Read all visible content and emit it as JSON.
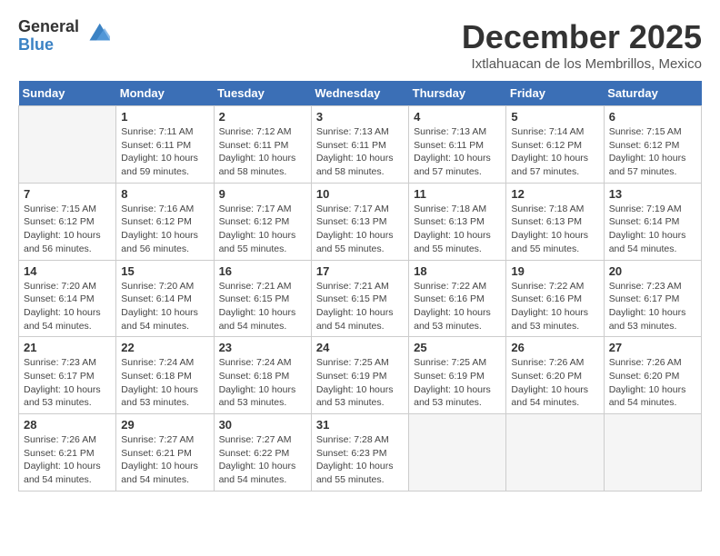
{
  "header": {
    "logo": {
      "general": "General",
      "blue": "Blue"
    },
    "title": "December 2025",
    "subtitle": "Ixtlahuacan de los Membrillos, Mexico"
  },
  "calendar": {
    "weekdays": [
      "Sunday",
      "Monday",
      "Tuesday",
      "Wednesday",
      "Thursday",
      "Friday",
      "Saturday"
    ],
    "weeks": [
      [
        {
          "day": "",
          "sunrise": "",
          "sunset": "",
          "daylight": ""
        },
        {
          "day": "1",
          "sunrise": "Sunrise: 7:11 AM",
          "sunset": "Sunset: 6:11 PM",
          "daylight": "Daylight: 10 hours and 59 minutes."
        },
        {
          "day": "2",
          "sunrise": "Sunrise: 7:12 AM",
          "sunset": "Sunset: 6:11 PM",
          "daylight": "Daylight: 10 hours and 58 minutes."
        },
        {
          "day": "3",
          "sunrise": "Sunrise: 7:13 AM",
          "sunset": "Sunset: 6:11 PM",
          "daylight": "Daylight: 10 hours and 58 minutes."
        },
        {
          "day": "4",
          "sunrise": "Sunrise: 7:13 AM",
          "sunset": "Sunset: 6:11 PM",
          "daylight": "Daylight: 10 hours and 57 minutes."
        },
        {
          "day": "5",
          "sunrise": "Sunrise: 7:14 AM",
          "sunset": "Sunset: 6:12 PM",
          "daylight": "Daylight: 10 hours and 57 minutes."
        },
        {
          "day": "6",
          "sunrise": "Sunrise: 7:15 AM",
          "sunset": "Sunset: 6:12 PM",
          "daylight": "Daylight: 10 hours and 57 minutes."
        }
      ],
      [
        {
          "day": "7",
          "sunrise": "Sunrise: 7:15 AM",
          "sunset": "Sunset: 6:12 PM",
          "daylight": "Daylight: 10 hours and 56 minutes."
        },
        {
          "day": "8",
          "sunrise": "Sunrise: 7:16 AM",
          "sunset": "Sunset: 6:12 PM",
          "daylight": "Daylight: 10 hours and 56 minutes."
        },
        {
          "day": "9",
          "sunrise": "Sunrise: 7:17 AM",
          "sunset": "Sunset: 6:12 PM",
          "daylight": "Daylight: 10 hours and 55 minutes."
        },
        {
          "day": "10",
          "sunrise": "Sunrise: 7:17 AM",
          "sunset": "Sunset: 6:13 PM",
          "daylight": "Daylight: 10 hours and 55 minutes."
        },
        {
          "day": "11",
          "sunrise": "Sunrise: 7:18 AM",
          "sunset": "Sunset: 6:13 PM",
          "daylight": "Daylight: 10 hours and 55 minutes."
        },
        {
          "day": "12",
          "sunrise": "Sunrise: 7:18 AM",
          "sunset": "Sunset: 6:13 PM",
          "daylight": "Daylight: 10 hours and 55 minutes."
        },
        {
          "day": "13",
          "sunrise": "Sunrise: 7:19 AM",
          "sunset": "Sunset: 6:14 PM",
          "daylight": "Daylight: 10 hours and 54 minutes."
        }
      ],
      [
        {
          "day": "14",
          "sunrise": "Sunrise: 7:20 AM",
          "sunset": "Sunset: 6:14 PM",
          "daylight": "Daylight: 10 hours and 54 minutes."
        },
        {
          "day": "15",
          "sunrise": "Sunrise: 7:20 AM",
          "sunset": "Sunset: 6:14 PM",
          "daylight": "Daylight: 10 hours and 54 minutes."
        },
        {
          "day": "16",
          "sunrise": "Sunrise: 7:21 AM",
          "sunset": "Sunset: 6:15 PM",
          "daylight": "Daylight: 10 hours and 54 minutes."
        },
        {
          "day": "17",
          "sunrise": "Sunrise: 7:21 AM",
          "sunset": "Sunset: 6:15 PM",
          "daylight": "Daylight: 10 hours and 54 minutes."
        },
        {
          "day": "18",
          "sunrise": "Sunrise: 7:22 AM",
          "sunset": "Sunset: 6:16 PM",
          "daylight": "Daylight: 10 hours and 53 minutes."
        },
        {
          "day": "19",
          "sunrise": "Sunrise: 7:22 AM",
          "sunset": "Sunset: 6:16 PM",
          "daylight": "Daylight: 10 hours and 53 minutes."
        },
        {
          "day": "20",
          "sunrise": "Sunrise: 7:23 AM",
          "sunset": "Sunset: 6:17 PM",
          "daylight": "Daylight: 10 hours and 53 minutes."
        }
      ],
      [
        {
          "day": "21",
          "sunrise": "Sunrise: 7:23 AM",
          "sunset": "Sunset: 6:17 PM",
          "daylight": "Daylight: 10 hours and 53 minutes."
        },
        {
          "day": "22",
          "sunrise": "Sunrise: 7:24 AM",
          "sunset": "Sunset: 6:18 PM",
          "daylight": "Daylight: 10 hours and 53 minutes."
        },
        {
          "day": "23",
          "sunrise": "Sunrise: 7:24 AM",
          "sunset": "Sunset: 6:18 PM",
          "daylight": "Daylight: 10 hours and 53 minutes."
        },
        {
          "day": "24",
          "sunrise": "Sunrise: 7:25 AM",
          "sunset": "Sunset: 6:19 PM",
          "daylight": "Daylight: 10 hours and 53 minutes."
        },
        {
          "day": "25",
          "sunrise": "Sunrise: 7:25 AM",
          "sunset": "Sunset: 6:19 PM",
          "daylight": "Daylight: 10 hours and 53 minutes."
        },
        {
          "day": "26",
          "sunrise": "Sunrise: 7:26 AM",
          "sunset": "Sunset: 6:20 PM",
          "daylight": "Daylight: 10 hours and 54 minutes."
        },
        {
          "day": "27",
          "sunrise": "Sunrise: 7:26 AM",
          "sunset": "Sunset: 6:20 PM",
          "daylight": "Daylight: 10 hours and 54 minutes."
        }
      ],
      [
        {
          "day": "28",
          "sunrise": "Sunrise: 7:26 AM",
          "sunset": "Sunset: 6:21 PM",
          "daylight": "Daylight: 10 hours and 54 minutes."
        },
        {
          "day": "29",
          "sunrise": "Sunrise: 7:27 AM",
          "sunset": "Sunset: 6:21 PM",
          "daylight": "Daylight: 10 hours and 54 minutes."
        },
        {
          "day": "30",
          "sunrise": "Sunrise: 7:27 AM",
          "sunset": "Sunset: 6:22 PM",
          "daylight": "Daylight: 10 hours and 54 minutes."
        },
        {
          "day": "31",
          "sunrise": "Sunrise: 7:28 AM",
          "sunset": "Sunset: 6:23 PM",
          "daylight": "Daylight: 10 hours and 55 minutes."
        },
        {
          "day": "",
          "sunrise": "",
          "sunset": "",
          "daylight": ""
        },
        {
          "day": "",
          "sunrise": "",
          "sunset": "",
          "daylight": ""
        },
        {
          "day": "",
          "sunrise": "",
          "sunset": "",
          "daylight": ""
        }
      ]
    ]
  }
}
